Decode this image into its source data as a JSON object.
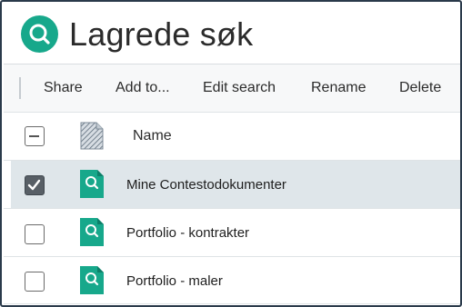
{
  "header": {
    "title": "Lagrede søk",
    "icon": "search-icon",
    "accent": "#17a88b"
  },
  "toolbar": {
    "share": "Share",
    "add_to": "Add to...",
    "edit_search": "Edit search",
    "rename": "Rename",
    "delete": "Delete"
  },
  "table": {
    "column_name": "Name",
    "rows": [
      {
        "name": "Mine Contestodokumenter",
        "checked": true,
        "icon": "saved-search-doc-icon"
      },
      {
        "name": "Portfolio - kontrakter",
        "checked": false,
        "icon": "saved-search-doc-icon"
      },
      {
        "name": "Portfolio - maler",
        "checked": false,
        "icon": "saved-search-doc-icon"
      }
    ]
  }
}
